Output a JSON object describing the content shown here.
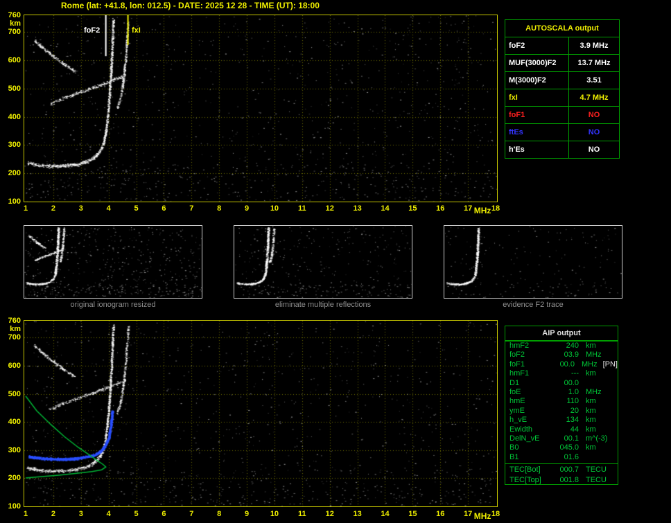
{
  "title": "Rome (lat: +41.8, lon: 012.5) - DATE: 2025 12 28 - TIME (UT): 18:00",
  "colors": {
    "background": "#000000",
    "axis_text": "#f0f000",
    "plot_border": "#c8c800",
    "grid": "#6f6f00",
    "table_border": "#00a000",
    "autoscala_header": "#f0f000",
    "aip_text": "#00c838",
    "caption_text": "#8f8f8f",
    "trace_white": "#ffffff",
    "profile_green": "#00b535",
    "restored_blue": "#2b50ff",
    "fxI_yellow": "#f0f000",
    "foF1_red": "#ff2020",
    "ftEs_blue": "#3333ff"
  },
  "autoscala": {
    "header": "AUTOSCALA output",
    "rows": [
      {
        "label": "foF2",
        "value": "3.9 MHz",
        "color": "#ffffff"
      },
      {
        "label": "MUF(3000)F2",
        "value": "13.7 MHz",
        "color": "#ffffff"
      },
      {
        "label": "M(3000)F2",
        "value": "3.51",
        "color": "#ffffff"
      },
      {
        "label": "fxI",
        "value": "4.7 MHz",
        "color": "#f0f000"
      },
      {
        "label": "foF1",
        "value": "NO",
        "color": "#ff2020"
      },
      {
        "label": "ftEs",
        "value": "NO",
        "color": "#3333ff"
      },
      {
        "label": "h'Es",
        "value": "NO",
        "color": "#ffffff"
      }
    ]
  },
  "aip": {
    "header": "AIP output",
    "rows": [
      {
        "label": "hmF2",
        "value": "240",
        "unit": "km",
        "extra": ""
      },
      {
        "label": "foF2",
        "value": "03.9",
        "unit": "MHz",
        "extra": ""
      },
      {
        "label": "foF1",
        "value": "00.0",
        "unit": "MHz",
        "extra": "[PN]"
      },
      {
        "label": "hmF1",
        "value": "---",
        "unit": "km",
        "extra": ""
      },
      {
        "label": "D1",
        "value": "00.0",
        "unit": "",
        "extra": ""
      },
      {
        "label": "foE",
        "value": "1.0",
        "unit": "MHz",
        "extra": ""
      },
      {
        "label": "hmE",
        "value": "110",
        "unit": "km",
        "extra": ""
      },
      {
        "label": "ymE",
        "value": "20",
        "unit": "km",
        "extra": ""
      },
      {
        "label": "h_vE",
        "value": "134",
        "unit": "km",
        "extra": ""
      },
      {
        "label": "Ewidth",
        "value": "44",
        "unit": "km",
        "extra": ""
      },
      {
        "label": "DelN_vE",
        "value": "00.1",
        "unit": "m^(-3)",
        "extra": ""
      },
      {
        "label": "B0",
        "value": "045.0",
        "unit": "km",
        "extra": ""
      },
      {
        "label": "B1",
        "value": "01.6",
        "unit": "",
        "extra": ""
      }
    ],
    "tec_rows": [
      {
        "label": "TEC[Bot]",
        "value": "000.7",
        "unit": "TECU",
        "extra": ""
      },
      {
        "label": "TEC[Top]",
        "value": "001.8",
        "unit": "TECU",
        "extra": ""
      }
    ]
  },
  "thumbnails": [
    {
      "caption": "original ionogram resized",
      "noise_dots": 420,
      "trace_indices": [
        0,
        1,
        2,
        3
      ]
    },
    {
      "caption": "eliminate multiple reflections",
      "noise_dots": 280,
      "trace_indices": [
        0,
        1
      ]
    },
    {
      "caption": "evidence F2 trace",
      "noise_dots": 150,
      "trace_indices": [
        0
      ]
    }
  ],
  "chart_data": [
    {
      "type": "scatter",
      "name": "scaled ionogram with AUTOSCALA markers",
      "xlabel": "MHz",
      "ylabel": "km",
      "xlim": [
        1,
        18
      ],
      "ylim": [
        100,
        760
      ],
      "xticks": [
        "1",
        "2",
        "3",
        "4",
        "5",
        "6",
        "7",
        "8",
        "9",
        "10",
        "11",
        "12",
        "13",
        "14",
        "15",
        "16",
        "17",
        "18"
      ],
      "yticks": [
        760,
        700,
        600,
        500,
        400,
        300,
        200,
        100
      ],
      "grid": true,
      "noise_dots": 850,
      "annotations": [
        {
          "text": "foF2",
          "f_mhz": 3.9,
          "color": "#ffffff"
        },
        {
          "text": "fxI",
          "f_mhz": 4.7,
          "color": "#f0f000"
        }
      ],
      "markers": [
        {
          "name": "foF2-line",
          "f_mhz": 3.9,
          "h_from": 760,
          "h_to": 615,
          "color": "#ffffff",
          "width": 2
        },
        {
          "name": "fxI-line",
          "f_mhz": 4.7,
          "h_from": 760,
          "h_to": 655,
          "color": "#f0f000",
          "width": 2
        }
      ],
      "traces": [
        {
          "name": "F2 trace 1st hop (o-mode)",
          "color": "#ffffff",
          "spread": 2.3,
          "density": 3.4,
          "points": [
            [
              1.05,
              238
            ],
            [
              1.4,
              230
            ],
            [
              1.9,
              226
            ],
            [
              2.4,
              227
            ],
            [
              2.9,
              233
            ],
            [
              3.2,
              242
            ],
            [
              3.45,
              255
            ],
            [
              3.65,
              275
            ],
            [
              3.8,
              305
            ],
            [
              3.9,
              355
            ],
            [
              3.98,
              430
            ],
            [
              4.05,
              520
            ],
            [
              4.1,
              610
            ],
            [
              4.14,
              700
            ],
            [
              4.16,
              745
            ]
          ]
        },
        {
          "name": "F2 trace x-mode cusp",
          "color": "#ffffff",
          "spread": 2.0,
          "density": 2.2,
          "points": [
            [
              4.3,
              430
            ],
            [
              4.42,
              470
            ],
            [
              4.52,
              530
            ],
            [
              4.6,
              600
            ],
            [
              4.66,
              690
            ],
            [
              4.7,
              740
            ]
          ]
        },
        {
          "name": "2nd hop arc",
          "color": "#ffffff",
          "spread": 2.2,
          "density": 2.4,
          "points": [
            [
              1.3,
              672
            ],
            [
              1.6,
              645
            ],
            [
              1.95,
              618
            ],
            [
              2.3,
              592
            ],
            [
              2.6,
              572
            ],
            [
              2.8,
              561
            ]
          ]
        },
        {
          "name": "2nd hop rising band",
          "color": "#ffffff",
          "spread": 2.4,
          "density": 2.0,
          "points": [
            [
              1.85,
              445
            ],
            [
              2.3,
              465
            ],
            [
              2.8,
              483
            ],
            [
              3.3,
              500
            ],
            [
              3.8,
              518
            ],
            [
              4.2,
              533
            ],
            [
              4.6,
              548
            ]
          ]
        }
      ],
      "lines": []
    },
    {
      "type": "scatter",
      "name": "ionogram with restored trace and electron density profile",
      "xlabel": "MHz",
      "ylabel": "km",
      "xlim": [
        1,
        18
      ],
      "ylim": [
        100,
        760
      ],
      "xticks": [
        "1",
        "2",
        "3",
        "4",
        "5",
        "6",
        "7",
        "8",
        "9",
        "10",
        "11",
        "12",
        "13",
        "14",
        "15",
        "16",
        "17",
        "18"
      ],
      "yticks": [
        760,
        700,
        600,
        500,
        400,
        300,
        200,
        100
      ],
      "grid": true,
      "noise_dots": 800,
      "annotations": [],
      "markers": [],
      "traces": [
        {
          "name": "F2 trace 1st hop (o-mode)",
          "color": "#ffffff",
          "spread": 2.3,
          "density": 3.2,
          "points": [
            [
              1.05,
              238
            ],
            [
              1.4,
              230
            ],
            [
              1.9,
              226
            ],
            [
              2.4,
              227
            ],
            [
              2.9,
              233
            ],
            [
              3.2,
              242
            ],
            [
              3.45,
              255
            ],
            [
              3.65,
              275
            ],
            [
              3.8,
              305
            ],
            [
              3.9,
              355
            ],
            [
              3.98,
              430
            ],
            [
              4.05,
              520
            ],
            [
              4.1,
              610
            ],
            [
              4.14,
              700
            ],
            [
              4.16,
              745
            ]
          ]
        },
        {
          "name": "F2 trace x-mode cusp",
          "color": "#ffffff",
          "spread": 2.0,
          "density": 2.0,
          "points": [
            [
              4.3,
              430
            ],
            [
              4.42,
              470
            ],
            [
              4.52,
              530
            ],
            [
              4.6,
              600
            ],
            [
              4.66,
              690
            ],
            [
              4.7,
              740
            ]
          ]
        },
        {
          "name": "2nd hop arc",
          "color": "#ffffff",
          "spread": 2.2,
          "density": 2.2,
          "points": [
            [
              1.3,
              672
            ],
            [
              1.6,
              645
            ],
            [
              1.95,
              618
            ],
            [
              2.3,
              592
            ],
            [
              2.6,
              572
            ],
            [
              2.8,
              561
            ]
          ]
        },
        {
          "name": "2nd hop rising band",
          "color": "#ffffff",
          "spread": 2.4,
          "density": 1.8,
          "points": [
            [
              1.85,
              445
            ],
            [
              2.3,
              465
            ],
            [
              2.8,
              483
            ],
            [
              3.3,
              500
            ],
            [
              3.8,
              518
            ],
            [
              4.2,
              533
            ],
            [
              4.6,
              548
            ]
          ]
        },
        {
          "name": "restored trace (blue)",
          "color": "#2b50ff",
          "spread": 1.6,
          "density": 6,
          "size": 2,
          "points": [
            [
              1.1,
              278
            ],
            [
              1.6,
              272
            ],
            [
              2.1,
              269
            ],
            [
              2.6,
              270
            ],
            [
              3.0,
              274
            ],
            [
              3.4,
              282
            ],
            [
              3.65,
              293
            ],
            [
              3.85,
              313
            ],
            [
              4.0,
              348
            ],
            [
              4.08,
              395
            ],
            [
              4.12,
              440
            ]
          ]
        }
      ],
      "lines": [
        {
          "name": "electron density profile N(h)",
          "color": "#00b535",
          "width": 1.5,
          "points": [
            [
              1.0,
              492
            ],
            [
              1.4,
              440
            ],
            [
              1.9,
              392
            ],
            [
              2.4,
              348
            ],
            [
              2.9,
              310
            ],
            [
              3.3,
              283
            ],
            [
              3.6,
              262
            ],
            [
              3.8,
              249
            ],
            [
              3.9,
              240
            ],
            [
              3.75,
              230
            ],
            [
              3.4,
              224
            ],
            [
              2.9,
              218
            ],
            [
              2.2,
              211
            ],
            [
              1.5,
              205
            ],
            [
              1.0,
              201
            ]
          ]
        }
      ]
    }
  ]
}
